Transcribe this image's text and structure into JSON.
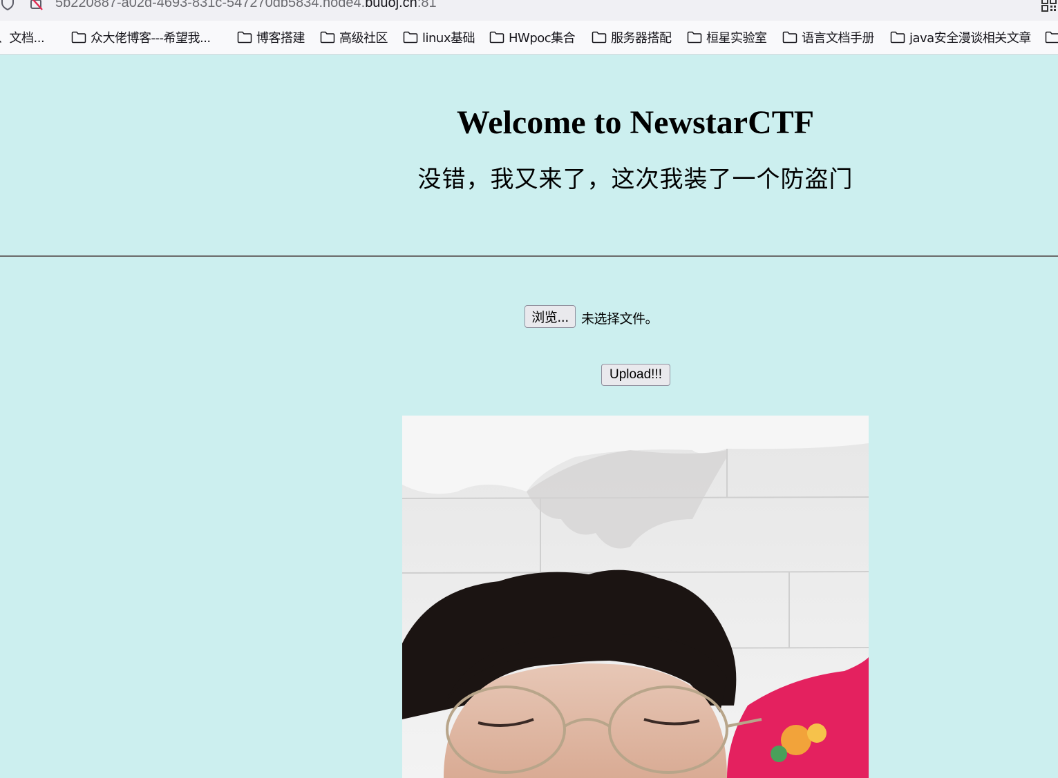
{
  "browser": {
    "url_prefix": "5b220887-a02d-4693-831c-547270db5834.node4.",
    "url_host": "buuoj.cn",
    "url_port": ":81",
    "bookmarks": [
      {
        "label": "、文档..."
      },
      {
        "label": "众大佬博客---希望我..."
      },
      {
        "label": "博客搭建"
      },
      {
        "label": "高级社区"
      },
      {
        "label": "linux基础"
      },
      {
        "label": "HWpoc集合"
      },
      {
        "label": "服务器搭配"
      },
      {
        "label": "桓星实验室"
      },
      {
        "label": "语言文档手册"
      },
      {
        "label": "java安全漫谈相关文章"
      }
    ]
  },
  "page": {
    "title": "Welcome to NewstarCTF",
    "subtitle": "没错，我又来了，这次我装了一个防盗门",
    "browse_label": "浏览...",
    "file_status": "未选择文件。",
    "upload_label": "Upload!!!"
  },
  "colors": {
    "page_background": "#ccefef",
    "button_background": "#e9e9ed"
  }
}
